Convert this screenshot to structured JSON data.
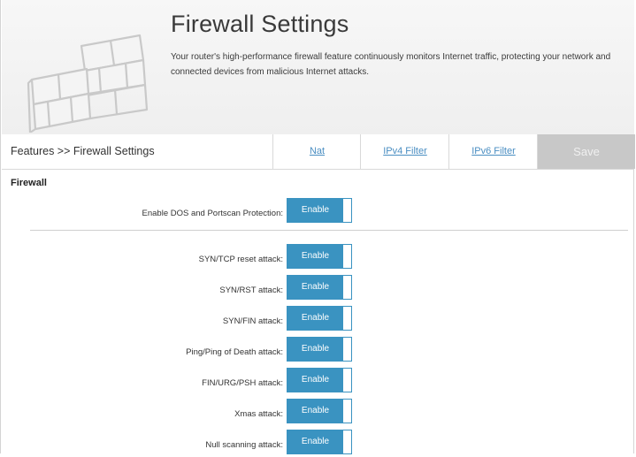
{
  "header": {
    "title": "Firewall Settings",
    "description": "Your router's high-performance firewall feature continuously monitors Internet traffic, protecting your network and connected devices from malicious Internet attacks."
  },
  "nav": {
    "breadcrumb": "Features >> Firewall Settings",
    "links": [
      "Nat",
      "IPv4 Filter",
      "IPv6 Filter"
    ],
    "save_label": "Save"
  },
  "firewall": {
    "section_title": "Firewall",
    "dos": {
      "label": "Enable DOS and Portscan Protection:",
      "state": "Enable"
    },
    "attacks": [
      {
        "label": "SYN/TCP reset attack:",
        "state": "Enable"
      },
      {
        "label": "SYN/RST attack:",
        "state": "Enable"
      },
      {
        "label": "SYN/FIN attack:",
        "state": "Enable"
      },
      {
        "label": "Ping/Ping of Death attack:",
        "state": "Enable"
      },
      {
        "label": "FIN/URG/PSH attack:",
        "state": "Enable"
      },
      {
        "label": "Xmas attack:",
        "state": "Enable"
      },
      {
        "label": "Null scanning attack:",
        "state": "Enable"
      }
    ]
  },
  "colors": {
    "accent": "#3a93c1",
    "link": "#4a8ec2",
    "save_disabled": "#c8c8c8"
  },
  "icons": {
    "header_illustration": "brick-wall-icon"
  }
}
